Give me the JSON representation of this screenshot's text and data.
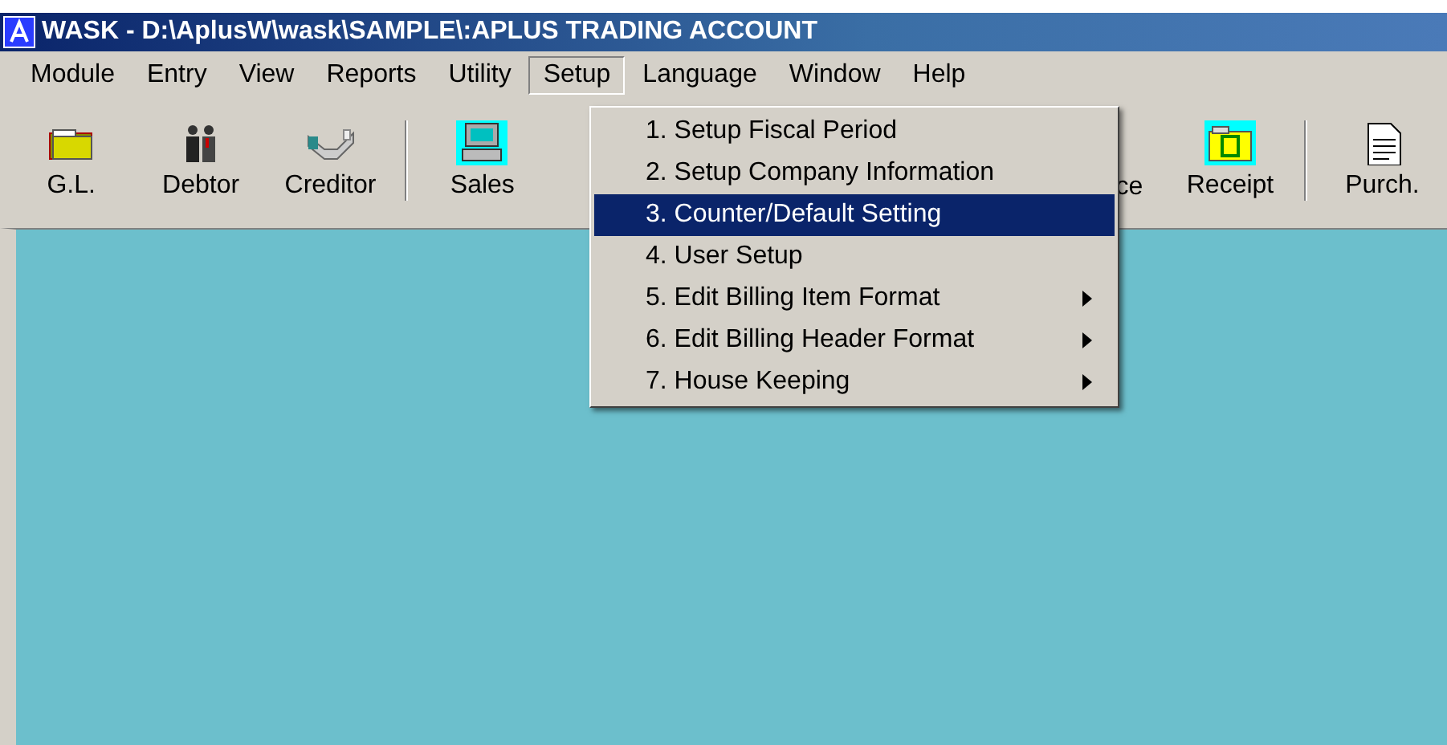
{
  "window": {
    "title": "WASK - D:\\AplusW\\wask\\SAMPLE\\:APLUS TRADING ACCOUNT"
  },
  "menu_bar": [
    {
      "label": "Module",
      "selected": false
    },
    {
      "label": "Entry",
      "selected": false
    },
    {
      "label": "View",
      "selected": false
    },
    {
      "label": "Reports",
      "selected": false
    },
    {
      "label": "Utility",
      "selected": false
    },
    {
      "label": "Setup",
      "selected": true
    },
    {
      "label": "Language",
      "selected": false
    },
    {
      "label": "Window",
      "selected": false
    },
    {
      "label": "Help",
      "selected": false
    }
  ],
  "toolbar": [
    {
      "kind": "folder",
      "label": "G.L."
    },
    {
      "kind": "people",
      "label": "Debtor"
    },
    {
      "kind": "handshake",
      "label": "Creditor"
    },
    {
      "kind": "separator"
    },
    {
      "kind": "computer",
      "label": "Sales"
    },
    {
      "kind": "partial",
      "label": "ce"
    },
    {
      "kind": "money",
      "label": "Receipt"
    },
    {
      "kind": "separator"
    },
    {
      "kind": "document",
      "label": "Purch."
    }
  ],
  "dropdown_menu": [
    {
      "label": "1. Setup Fiscal Period",
      "selected": false,
      "submenu": false
    },
    {
      "label": "2. Setup Company Information",
      "selected": false,
      "submenu": false
    },
    {
      "label": "3. Counter/Default Setting",
      "selected": true,
      "submenu": false
    },
    {
      "label": "4. User Setup",
      "selected": false,
      "submenu": false
    },
    {
      "label": "5. Edit Billing Item Format",
      "selected": false,
      "submenu": true
    },
    {
      "label": "6. Edit Billing Header Format",
      "selected": false,
      "submenu": true
    },
    {
      "label": "7. House Keeping",
      "selected": false,
      "submenu": true
    }
  ]
}
